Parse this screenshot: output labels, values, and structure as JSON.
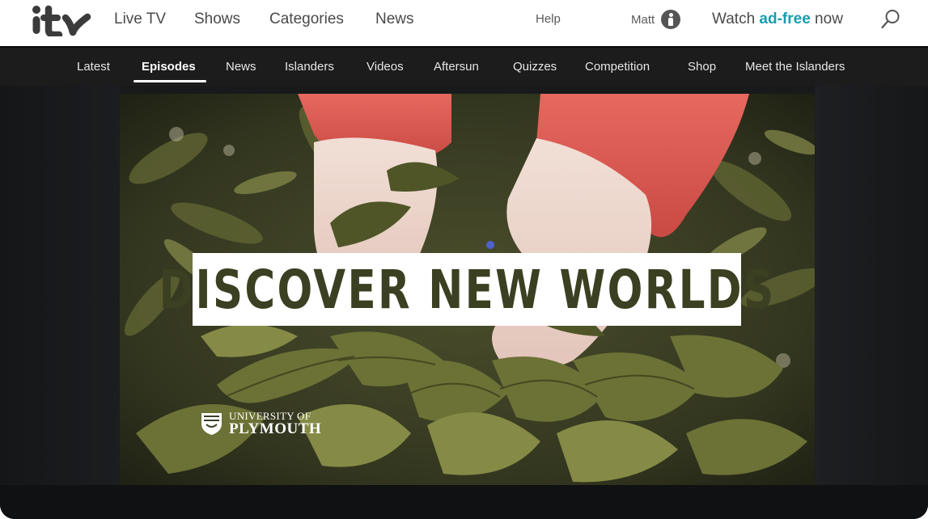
{
  "header": {
    "logo_text": "itv",
    "nav": [
      "Live TV",
      "Shows",
      "Categories",
      "News"
    ],
    "help": "Help",
    "user_name": "Matt",
    "adfree_prefix": "Watch ",
    "adfree_accent": "ad-free",
    "adfree_suffix": " now",
    "search_icon": "search-icon"
  },
  "subnav": {
    "items": [
      "Latest",
      "Episodes",
      "News",
      "Islanders",
      "Videos",
      "Aftersun",
      "Quizzes",
      "Competition",
      "Shop",
      "Meet the Islanders"
    ],
    "active": "Episodes"
  },
  "video": {
    "headline": "DISCOVER NEW WORLDS",
    "sponsor_line1": "UNIVERSITY OF",
    "sponsor_line2": "PLYMOUTH"
  },
  "colors": {
    "accent": "#1a9dae",
    "subnav_bg": "#1c1c1c",
    "logo": "#3b3b3b"
  }
}
